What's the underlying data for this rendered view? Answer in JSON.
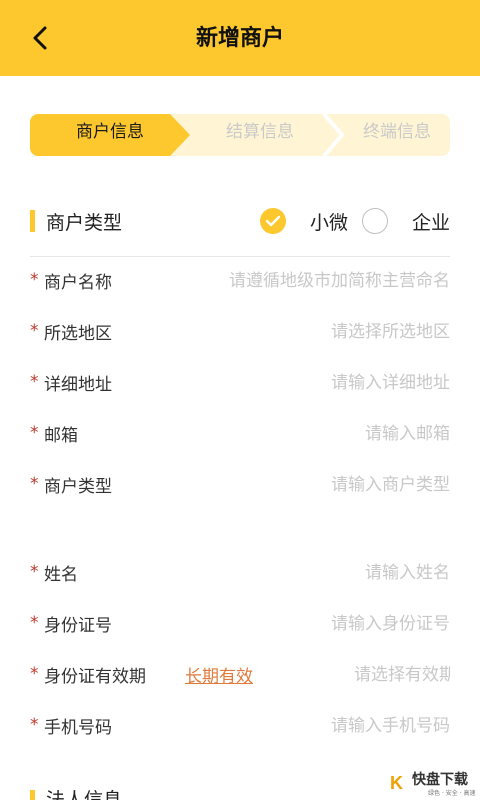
{
  "header": {
    "title": "新增商户",
    "back_icon": "chevron-left-icon"
  },
  "steps": [
    {
      "label": "商户信息",
      "active": true
    },
    {
      "label": "结算信息",
      "active": false
    },
    {
      "label": "终端信息",
      "active": false
    }
  ],
  "merchant_type_section": {
    "label": "商户类型",
    "options": [
      {
        "label": "小微",
        "checked": true
      },
      {
        "label": "企业",
        "checked": false
      }
    ]
  },
  "merchant_fields": [
    {
      "label": "商户名称",
      "placeholder": "请遵循地级市加简称主营命名",
      "required": true
    },
    {
      "label": "所选地区",
      "placeholder": "请选择所选地区",
      "required": true
    },
    {
      "label": "详细地址",
      "placeholder": "请输入详细地址",
      "required": true
    },
    {
      "label": "邮箱",
      "placeholder": "请输入邮箱",
      "required": true
    },
    {
      "label": "商户类型",
      "placeholder": "请输入商户类型",
      "required": true
    }
  ],
  "person_fields": [
    {
      "label": "姓名",
      "placeholder": "请输入姓名",
      "required": true
    },
    {
      "label": "身份证号",
      "placeholder": "请输入身份证号",
      "required": true
    },
    {
      "label": "身份证有效期",
      "link": "长期有效",
      "placeholder": "请选择有效期",
      "required": true
    },
    {
      "label": "手机号码",
      "placeholder": "请输入手机号码",
      "required": true
    }
  ],
  "required_mark": "*",
  "bottom_section": {
    "label": "法人信息"
  },
  "watermark": {
    "mark": "K",
    "brand": "快盘下载",
    "tagline": "绿色 · 安全 · 高速"
  },
  "colors": {
    "accent": "#fdc82e",
    "required": "#c0392b",
    "link": "#e07a3d",
    "placeholder": "#c8c8c8"
  }
}
